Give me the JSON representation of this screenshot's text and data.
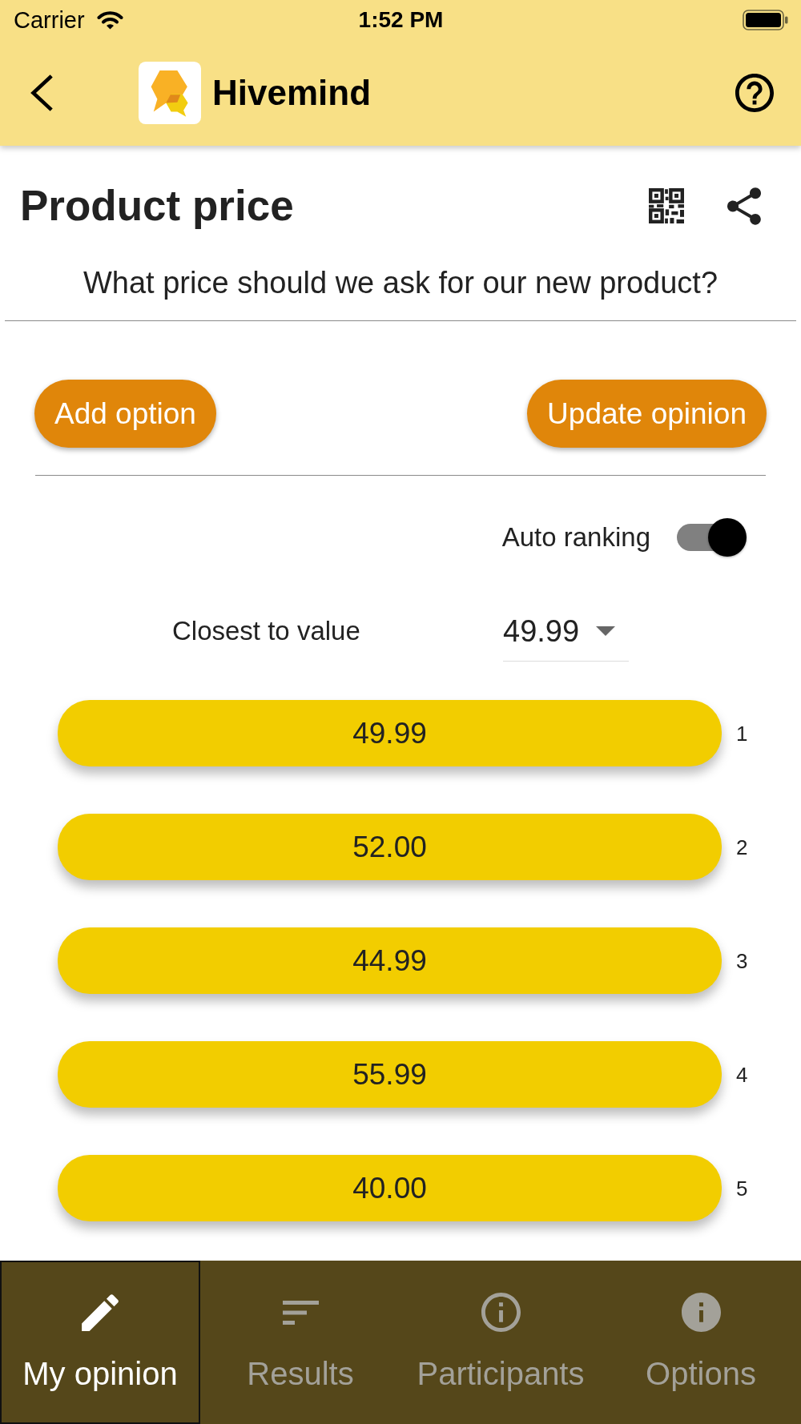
{
  "status_bar": {
    "carrier": "Carrier",
    "time": "1:52 PM"
  },
  "header": {
    "app_name": "Hivemind"
  },
  "poll": {
    "title": "Product price",
    "question": "What price should we ask for our new product?"
  },
  "actions": [
    {
      "label": "Add option"
    },
    {
      "label": "Update opinion"
    }
  ],
  "auto_ranking": {
    "label": "Auto ranking",
    "on": true
  },
  "ranking_rule": {
    "label": "Closest to value",
    "value": "49.99"
  },
  "options": [
    {
      "label": "49.99",
      "rank": "1"
    },
    {
      "label": "52.00",
      "rank": "2"
    },
    {
      "label": "44.99",
      "rank": "3"
    },
    {
      "label": "55.99",
      "rank": "4"
    },
    {
      "label": "40.00",
      "rank": "5"
    }
  ],
  "bottom_nav": [
    {
      "label": "My opinion",
      "selected": true
    },
    {
      "label": "Results",
      "selected": false
    },
    {
      "label": "Participants",
      "selected": false
    },
    {
      "label": "Options",
      "selected": false
    }
  ]
}
